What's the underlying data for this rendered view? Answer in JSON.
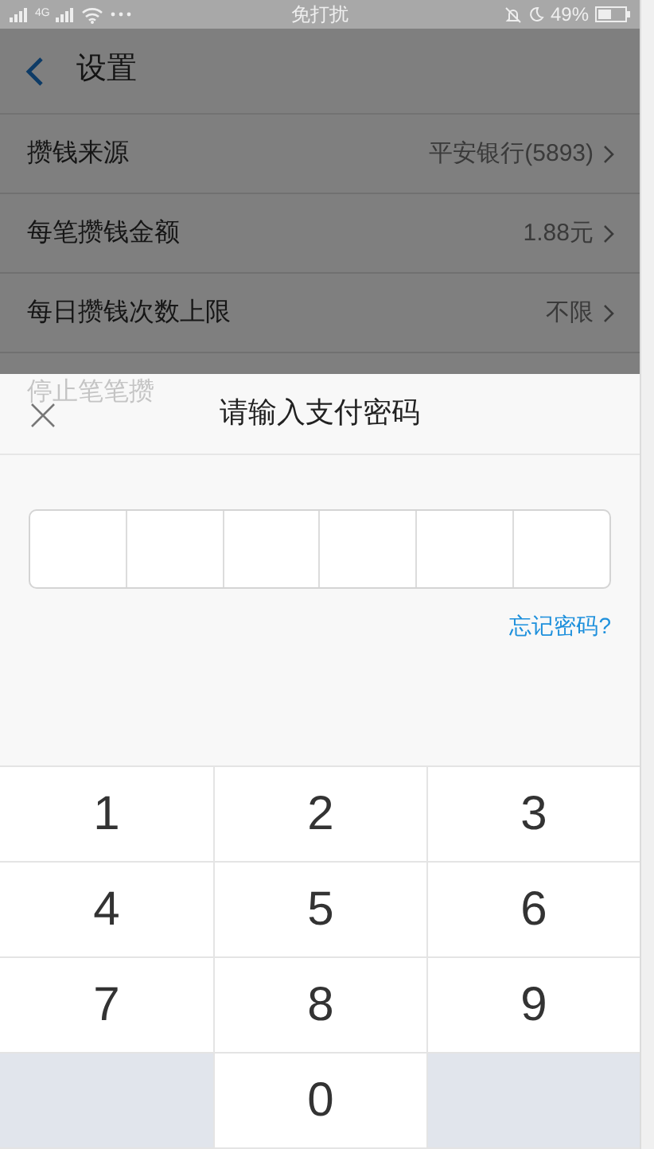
{
  "status_bar": {
    "network": "4G",
    "center": "免打扰",
    "battery": "49%"
  },
  "header": {
    "title": "设置"
  },
  "rows": [
    {
      "label": "攒钱来源",
      "value": "平安银行(5893)"
    },
    {
      "label": "每笔攒钱金额",
      "value": "1.88元"
    },
    {
      "label": "每日攒钱次数上限",
      "value": "不限"
    }
  ],
  "ghost_row": {
    "label": "停止笔笔攒"
  },
  "sheet": {
    "title": "请输入支付密码",
    "forgot_link": "忘记密码?"
  },
  "keypad": [
    {
      "kind": "digit",
      "label": "1"
    },
    {
      "kind": "digit",
      "label": "2"
    },
    {
      "kind": "digit",
      "label": "3"
    },
    {
      "kind": "digit",
      "label": "4"
    },
    {
      "kind": "digit",
      "label": "5"
    },
    {
      "kind": "digit",
      "label": "6"
    },
    {
      "kind": "digit",
      "label": "7"
    },
    {
      "kind": "digit",
      "label": "8"
    },
    {
      "kind": "digit",
      "label": "9"
    },
    {
      "kind": "blank"
    },
    {
      "kind": "digit",
      "label": "0"
    },
    {
      "kind": "blank"
    }
  ]
}
